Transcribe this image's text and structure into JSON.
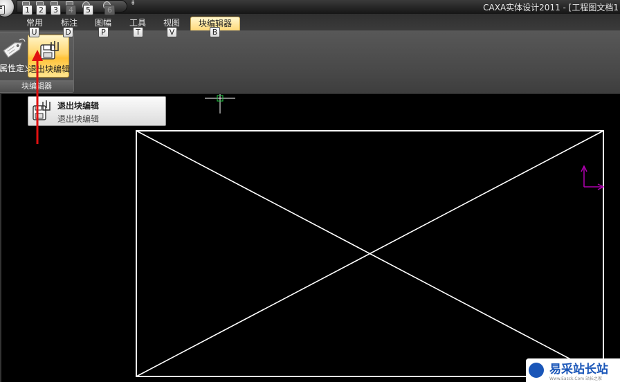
{
  "window": {
    "title": "CAXA实体设计2011 - [工程图文档1"
  },
  "app_menu": {
    "keytip": "F"
  },
  "quick_access": {
    "keytips": [
      "1",
      "2",
      "3",
      "4",
      "5",
      "6"
    ],
    "dropdown_glyph": "⇟"
  },
  "tabs": [
    {
      "label": "常用",
      "keytip": "U",
      "active": false
    },
    {
      "label": "标注",
      "keytip": "D",
      "active": false
    },
    {
      "label": "图幅",
      "keytip": "P",
      "active": false
    },
    {
      "label": "工具",
      "keytip": "T",
      "active": false
    },
    {
      "label": "视图",
      "keytip": "V",
      "active": false
    },
    {
      "label": "块编辑器",
      "keytip": "B",
      "active": true
    }
  ],
  "ribbon": {
    "group": {
      "caption": "块编辑器",
      "buttons": [
        {
          "label": "属性定义",
          "icon": "tag-icon",
          "highlighted": false
        },
        {
          "label": "退出块编辑",
          "icon": "floppy-exit-icon",
          "highlighted": true
        }
      ]
    }
  },
  "tooltip": {
    "title": "退出块编辑",
    "description": "退出块编辑"
  },
  "drawing": {
    "line_color": "#ffffff",
    "cursor_color": "#ffffff",
    "cursor_box_color": "#22cc44",
    "axis_color": "#b000b0",
    "arrow_color": "#e01010"
  },
  "watermark": {
    "name": "易采站长站",
    "url": "Www.Easck.Com  站长之家"
  }
}
